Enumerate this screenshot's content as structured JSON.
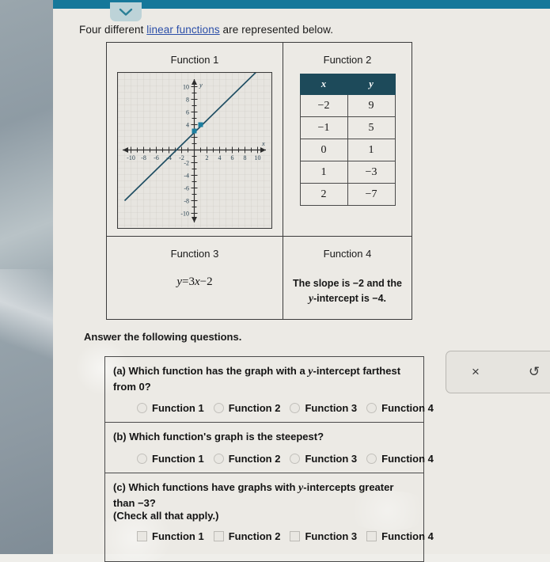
{
  "header": {
    "collapse_tab_icon": "chevron-down-icon",
    "bar_color": "#16789a",
    "tab_color": "#bdd3d8"
  },
  "prompt": {
    "before": "Four different ",
    "link": "linear functions",
    "after": " are represented below."
  },
  "functions": {
    "f1": {
      "title": "Function 1",
      "type": "graph",
      "graph": {
        "xlabel": "x",
        "ylabel": "y",
        "x_ticks": [
          -10,
          -8,
          -6,
          -4,
          -2,
          2,
          4,
          6,
          8,
          10
        ],
        "y_ticks": [
          10,
          8,
          6,
          4,
          -2,
          -4,
          -6,
          -8,
          -10
        ],
        "xlim": [
          -11,
          11
        ],
        "ylim": [
          -11,
          11
        ],
        "slope": 1,
        "intercept": 3,
        "points": [
          [
            0,
            3
          ],
          [
            1,
            4
          ]
        ],
        "line_color": "#1a6f8f",
        "grid": true
      }
    },
    "f2": {
      "title": "Function 2",
      "type": "table",
      "columns": [
        "x",
        "y"
      ],
      "rows": [
        [
          "−2",
          "9"
        ],
        [
          "−1",
          "5"
        ],
        [
          "0",
          "1"
        ],
        [
          "1",
          "−3"
        ],
        [
          "2",
          "−7"
        ]
      ],
      "header_color": "#1d4a5a"
    },
    "f3": {
      "title": "Function 3",
      "type": "equation",
      "equation_lhs": "y",
      "equation_eq": "=",
      "equation_rhs_coef": "3",
      "equation_rhs_var": "x",
      "equation_rhs_const": "−2"
    },
    "f4": {
      "title": "Function 4",
      "type": "description",
      "line1": "The slope is −2 and the",
      "line2_pre": "",
      "line2_italic": "y",
      "line2_post": "-intercept is −4."
    }
  },
  "answer_heading": "Answer the following questions.",
  "questions": [
    {
      "id": "a",
      "label": "(a)",
      "text_pre": "Which function has the graph with a ",
      "text_italic": "y",
      "text_post": "-intercept farthest from 0?",
      "input_type": "radio",
      "options": [
        "Function 1",
        "Function 2",
        "Function 3",
        "Function 4"
      ]
    },
    {
      "id": "b",
      "label": "(b)",
      "text_pre": "Which function's graph is the steepest?",
      "text_italic": "",
      "text_post": "",
      "input_type": "radio",
      "options": [
        "Function 1",
        "Function 2",
        "Function 3",
        "Function 4"
      ]
    },
    {
      "id": "c",
      "label": "(c)",
      "text_pre": "Which functions have graphs with ",
      "text_italic": "y",
      "text_post": "-intercepts greater than −3?",
      "subtext": "(Check all that apply.)",
      "input_type": "checkbox",
      "options": [
        "Function 1",
        "Function 2",
        "Function 3",
        "Function 4"
      ]
    }
  ],
  "tool_panel": {
    "clear_label": "×",
    "clear_icon": "close-icon",
    "undo_label": "↺",
    "undo_icon": "undo-icon"
  }
}
